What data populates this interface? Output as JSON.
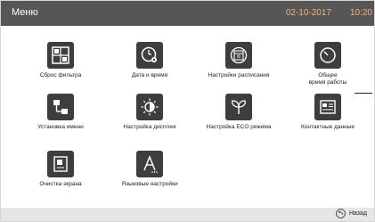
{
  "header": {
    "title": "Меню",
    "date": "02-10-2017",
    "time": "10:20"
  },
  "tiles": [
    {
      "label": "Сброс фильтра",
      "icon": "filter-grid-icon"
    },
    {
      "label": "Дата и время",
      "icon": "clock-gear-icon"
    },
    {
      "label": "Настройки расписания",
      "icon": "calendar-icon"
    },
    {
      "label": "Общее\nвремя работы",
      "icon": "timer-icon"
    },
    {
      "label": "Установка имени",
      "icon": "network-tree-icon"
    },
    {
      "label": "Настройка дисплея",
      "icon": "brightness-icon"
    },
    {
      "label": "Настройка ECO режима",
      "icon": "leaf-icon"
    },
    {
      "label": "Контактные данные",
      "icon": "contact-card-icon"
    },
    {
      "label": "Очистка экрана",
      "icon": "screen-clean-icon"
    },
    {
      "label": "Языковые настройки",
      "icon": "language-a-icon"
    }
  ],
  "footer": {
    "back_label": "Назад"
  },
  "colors": {
    "topbar": "#565656",
    "date_time": "#f2b27a",
    "icon_bg": "#3e3e3e",
    "bottombar": "#e6e6e6"
  }
}
